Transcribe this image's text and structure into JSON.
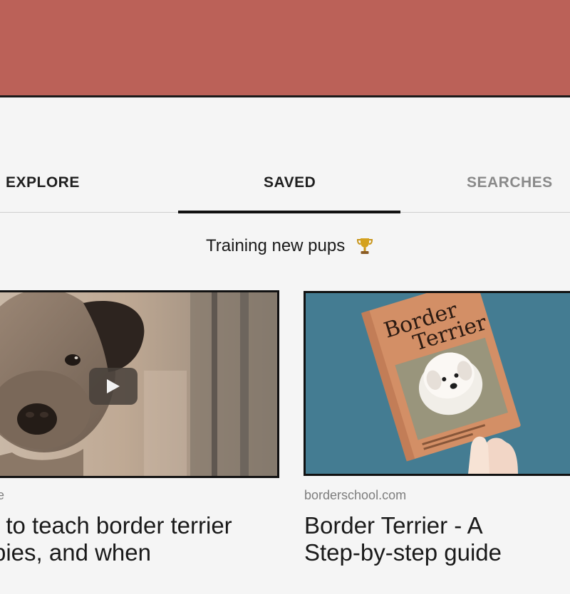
{
  "header": {
    "color": "#bb6158"
  },
  "tabs": [
    {
      "label": "EXPLORE",
      "state": "inactive"
    },
    {
      "label": "SAVED",
      "state": "active"
    },
    {
      "label": "SEARCHES",
      "state": "inactive"
    }
  ],
  "board": {
    "title": "Training new pups",
    "icon": "trophy-icon"
  },
  "cards": [
    {
      "source": "e",
      "title_lines": [
        "t to teach border terrier",
        "pies, and when"
      ],
      "media": "video",
      "icon": "play-icon"
    },
    {
      "source": "borderschool.com",
      "title_lines": [
        "Border Terrier - A",
        "Step-by-step guide"
      ],
      "media": "image",
      "book": {
        "title_line1": "Border",
        "title_line2": "Terrier"
      }
    }
  ]
}
